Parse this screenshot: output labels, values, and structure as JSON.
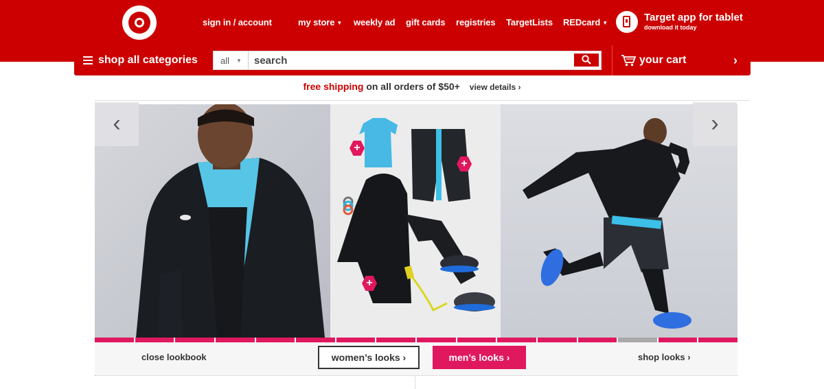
{
  "colors": {
    "brand_red": "#cc0000",
    "accent_pink": "#e0185e",
    "background": "#ffffff"
  },
  "header": {
    "logo": "target-bullseye-logo",
    "nav": {
      "sign_in": "sign in / account",
      "my_store": "my store",
      "weekly_ad": "weekly ad",
      "gift_cards": "gift cards",
      "registries": "registries",
      "target_lists": "TargetLists",
      "redcard": "REDcard"
    },
    "app_promo": {
      "title": "Target app for tablet",
      "subtitle": "download it today",
      "icon": "tablet-icon"
    }
  },
  "shopbar": {
    "categories_label": "shop all categories",
    "search": {
      "scope": "all",
      "placeholder": "search",
      "value": ""
    },
    "cart_label": "your cart"
  },
  "shipping": {
    "highlight": "free shipping",
    "text": "on all orders of $50+",
    "link": "view details ›"
  },
  "carousel": {
    "panels": [
      "man-in-black-hoodie-photo",
      "athletic-gear-flatlay-photo",
      "man-jumping-photo"
    ],
    "hotspot_label": "+",
    "prev_label": "‹",
    "next_label": "›",
    "page_count": 16,
    "active_page": 13
  },
  "lookbook": {
    "close_label": "close lookbook",
    "womens_label": "women’s looks ›",
    "mens_label": "men’s looks ›",
    "shop_label": "shop looks ›"
  }
}
